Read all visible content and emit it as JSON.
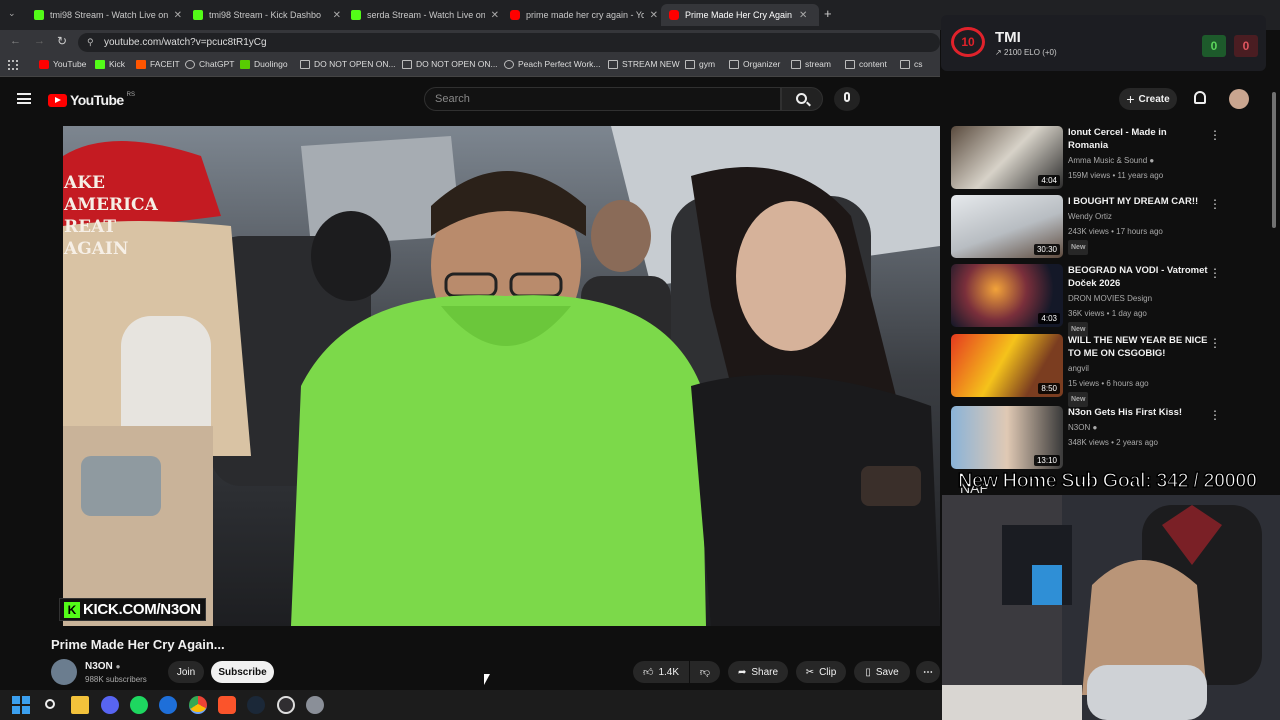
{
  "browser": {
    "tabs": [
      {
        "title": "tmi98 Stream - Watch Live on K",
        "icon": "kick-icon"
      },
      {
        "title": "tmi98 Stream - Kick Dashbo",
        "icon": "kick-icon"
      },
      {
        "title": "serda Stream - Watch Live on K",
        "icon": "kick-icon"
      },
      {
        "title": "prime made her cry again - You",
        "icon": "youtube-icon"
      },
      {
        "title": "Prime Made Her Cry Again",
        "icon": "youtube-icon"
      }
    ],
    "url": "youtube.com/watch?v=pcuc8tR1yCg",
    "bookmarks": [
      "YouTube",
      "Kick",
      "FACEIT",
      "ChatGPT",
      "Duolingo",
      "DO NOT OPEN ON...",
      "DO NOT OPEN ON...",
      "Peach Perfect Work...",
      "STREAM NEW",
      "gym",
      "Organizer",
      "stream",
      "content",
      "cs"
    ]
  },
  "youtube": {
    "logo_text": "YouTube",
    "region": "RS",
    "search_placeholder": "Search",
    "create_label": "Create"
  },
  "video": {
    "title": "Prime Made Her Cry Again...",
    "overlay_text": "KICK.COM/N3ON",
    "hat_text": "AKE AMERICA REAT AGAIN",
    "channel": "N3ON",
    "subscribers": "988K subscribers",
    "join_label": "Join",
    "subscribe_label": "Subscribe",
    "likes": "1.4K",
    "share_label": "Share",
    "clip_label": "Clip",
    "save_label": "Save"
  },
  "recommendations": [
    {
      "title": "Ionut Cercel - Made in Romania",
      "channel": "Amma Music & Sound",
      "verified": true,
      "meta": "159M views • 11 years ago",
      "duration": "4:04",
      "badge": ""
    },
    {
      "title": "I BOUGHT MY DREAM CAR!!",
      "channel": "Wendy Ortiz",
      "verified": false,
      "meta": "243K views • 17 hours ago",
      "duration": "30:30",
      "badge": "New"
    },
    {
      "title": "BEOGRAD NA VODI - Vatromet Doček 2026",
      "channel": "DRON MOVIES Design",
      "verified": false,
      "meta": "36K views • 1 day ago",
      "duration": "4:03",
      "badge": "New"
    },
    {
      "title": "WILL THE NEW YEAR BE NICE TO ME ON CSGOBIG!",
      "channel": "angvil",
      "verified": false,
      "meta": "15 views • 6 hours ago",
      "duration": "8:50",
      "badge": "New"
    },
    {
      "title": "N3on Gets His First Kiss!",
      "channel": "N3ON",
      "verified": true,
      "meta": "348K views • 2 years ago",
      "duration": "13:10",
      "badge": ""
    }
  ],
  "overlay": {
    "tmi_name": "TMI",
    "tmi_level": "10",
    "tmi_elo": "2100 ELO (+0)",
    "score_left": "0",
    "score_right": "0",
    "sub_goal": "New Home Sub Goal:  342 / 20000",
    "partial_text": "NAP"
  },
  "colors": {
    "accent_red": "#ff0000",
    "hoodie_green": "#7cd94a",
    "kick_green": "#53fc18",
    "bg": "#0f0f0f"
  }
}
